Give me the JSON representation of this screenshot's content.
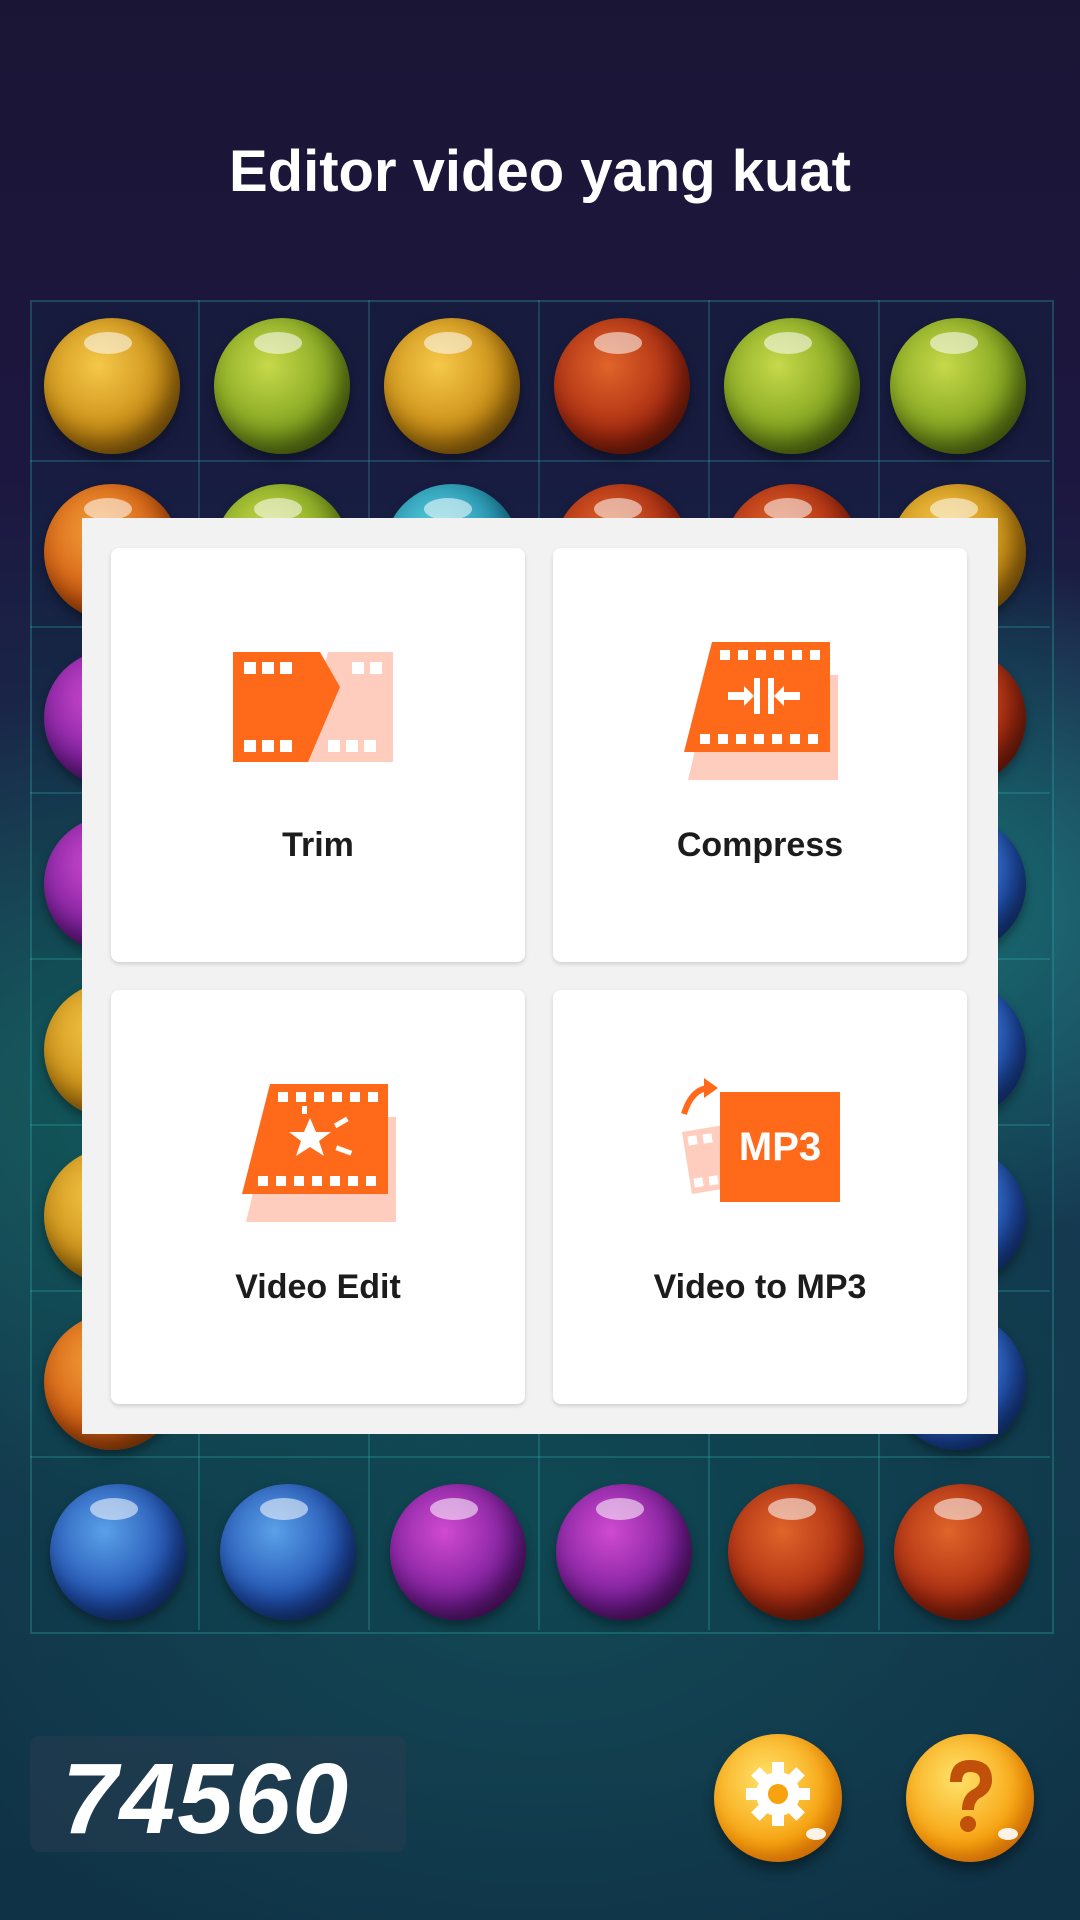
{
  "header": {
    "title": "Editor video yang kuat"
  },
  "menu": {
    "items": [
      {
        "label": "Trim",
        "icon": "trim-icon"
      },
      {
        "label": "Compress",
        "icon": "compress-icon"
      },
      {
        "label": "Video Edit",
        "icon": "video-edit-icon"
      },
      {
        "label": "Video to MP3",
        "icon": "video-to-mp3-icon",
        "badge": "MP3"
      }
    ]
  },
  "game": {
    "score": "74560",
    "buttons": {
      "settings": "gear-icon",
      "help": "question-icon"
    }
  },
  "colors": {
    "accent": "#ff6a1a",
    "accent_light": "#ffcdbd",
    "button_gold": "#f7a20e"
  }
}
